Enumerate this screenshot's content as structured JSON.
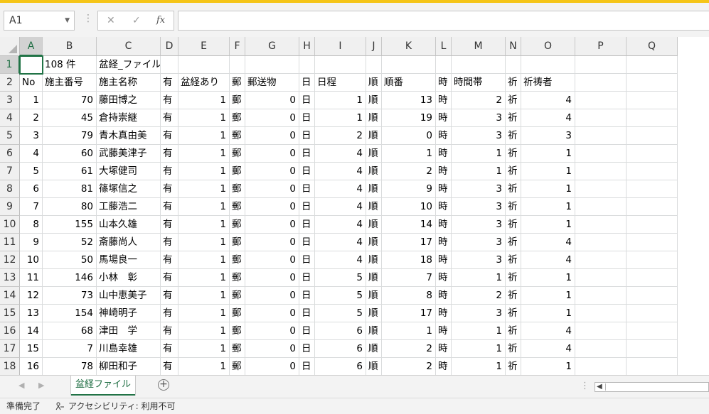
{
  "formula_bar": {
    "name_box": "A1",
    "cancel_icon": "✕",
    "enter_icon": "✓",
    "fx_label": "fx",
    "formula": ""
  },
  "columns": [
    "A",
    "B",
    "C",
    "D",
    "E",
    "F",
    "G",
    "H",
    "I",
    "J",
    "K",
    "L",
    "M",
    "N",
    "O",
    "P",
    "Q"
  ],
  "rows": [
    {
      "n": "1",
      "cells": [
        "",
        "108 件",
        "盆経_ファイル",
        "",
        "",
        "",
        "",
        "",
        "",
        "",
        "",
        "",
        "",
        "",
        "",
        "",
        ""
      ]
    },
    {
      "n": "2",
      "cells": [
        "No",
        "施主番号",
        "施主名称",
        "有",
        "盆経あり",
        "郵",
        "郵送物",
        "日",
        "日程",
        "順",
        "順番",
        "時",
        "時間帯",
        "祈",
        "祈祷者",
        "",
        ""
      ]
    },
    {
      "n": "3",
      "cells": [
        "1",
        "70",
        "藤田博之",
        "有",
        "1",
        "郵",
        "0",
        "日",
        "1",
        "順",
        "13",
        "時",
        "2",
        "祈",
        "4",
        "",
        ""
      ]
    },
    {
      "n": "4",
      "cells": [
        "2",
        "45",
        "倉持崇継",
        "有",
        "1",
        "郵",
        "0",
        "日",
        "1",
        "順",
        "19",
        "時",
        "3",
        "祈",
        "4",
        "",
        ""
      ]
    },
    {
      "n": "5",
      "cells": [
        "3",
        "79",
        "青木真由美",
        "有",
        "1",
        "郵",
        "0",
        "日",
        "2",
        "順",
        "0",
        "時",
        "3",
        "祈",
        "3",
        "",
        ""
      ]
    },
    {
      "n": "6",
      "cells": [
        "4",
        "60",
        "武藤美津子",
        "有",
        "1",
        "郵",
        "0",
        "日",
        "4",
        "順",
        "1",
        "時",
        "1",
        "祈",
        "1",
        "",
        ""
      ]
    },
    {
      "n": "7",
      "cells": [
        "5",
        "61",
        "大塚健司",
        "有",
        "1",
        "郵",
        "0",
        "日",
        "4",
        "順",
        "2",
        "時",
        "1",
        "祈",
        "1",
        "",
        ""
      ]
    },
    {
      "n": "8",
      "cells": [
        "6",
        "81",
        "篠塚信之",
        "有",
        "1",
        "郵",
        "0",
        "日",
        "4",
        "順",
        "9",
        "時",
        "3",
        "祈",
        "1",
        "",
        ""
      ]
    },
    {
      "n": "9",
      "cells": [
        "7",
        "80",
        "工藤浩二",
        "有",
        "1",
        "郵",
        "0",
        "日",
        "4",
        "順",
        "10",
        "時",
        "3",
        "祈",
        "1",
        "",
        ""
      ]
    },
    {
      "n": "10",
      "cells": [
        "8",
        "155",
        "山本久雄",
        "有",
        "1",
        "郵",
        "0",
        "日",
        "4",
        "順",
        "14",
        "時",
        "3",
        "祈",
        "1",
        "",
        ""
      ]
    },
    {
      "n": "11",
      "cells": [
        "9",
        "52",
        "斎藤尚人",
        "有",
        "1",
        "郵",
        "0",
        "日",
        "4",
        "順",
        "17",
        "時",
        "3",
        "祈",
        "4",
        "",
        ""
      ]
    },
    {
      "n": "12",
      "cells": [
        "10",
        "50",
        "馬場良一",
        "有",
        "1",
        "郵",
        "0",
        "日",
        "4",
        "順",
        "18",
        "時",
        "3",
        "祈",
        "4",
        "",
        ""
      ]
    },
    {
      "n": "13",
      "cells": [
        "11",
        "146",
        "小林　彰",
        "有",
        "1",
        "郵",
        "0",
        "日",
        "5",
        "順",
        "7",
        "時",
        "1",
        "祈",
        "1",
        "",
        ""
      ]
    },
    {
      "n": "14",
      "cells": [
        "12",
        "73",
        "山中恵美子",
        "有",
        "1",
        "郵",
        "0",
        "日",
        "5",
        "順",
        "8",
        "時",
        "2",
        "祈",
        "1",
        "",
        ""
      ]
    },
    {
      "n": "15",
      "cells": [
        "13",
        "154",
        "神崎明子",
        "有",
        "1",
        "郵",
        "0",
        "日",
        "5",
        "順",
        "17",
        "時",
        "3",
        "祈",
        "1",
        "",
        ""
      ]
    },
    {
      "n": "16",
      "cells": [
        "14",
        "68",
        "津田　学",
        "有",
        "1",
        "郵",
        "0",
        "日",
        "6",
        "順",
        "1",
        "時",
        "1",
        "祈",
        "4",
        "",
        ""
      ]
    },
    {
      "n": "17",
      "cells": [
        "15",
        "7",
        "川島幸雄",
        "有",
        "1",
        "郵",
        "0",
        "日",
        "6",
        "順",
        "2",
        "時",
        "1",
        "祈",
        "4",
        "",
        ""
      ]
    },
    {
      "n": "18",
      "cells": [
        "16",
        "78",
        "柳田和子",
        "有",
        "1",
        "郵",
        "0",
        "日",
        "6",
        "順",
        "2",
        "時",
        "1",
        "祈",
        "1",
        "",
        ""
      ]
    }
  ],
  "sheet_tabs": [
    "盆経ファイル"
  ],
  "status": {
    "ready": "準備完了",
    "accessibility": "アクセシビリティ: 利用不可"
  },
  "colors": {
    "accent": "#217346",
    "top_strip": "#f5c518",
    "grid_line": "#dadcdd",
    "header_bg": "#f0f0f0"
  }
}
